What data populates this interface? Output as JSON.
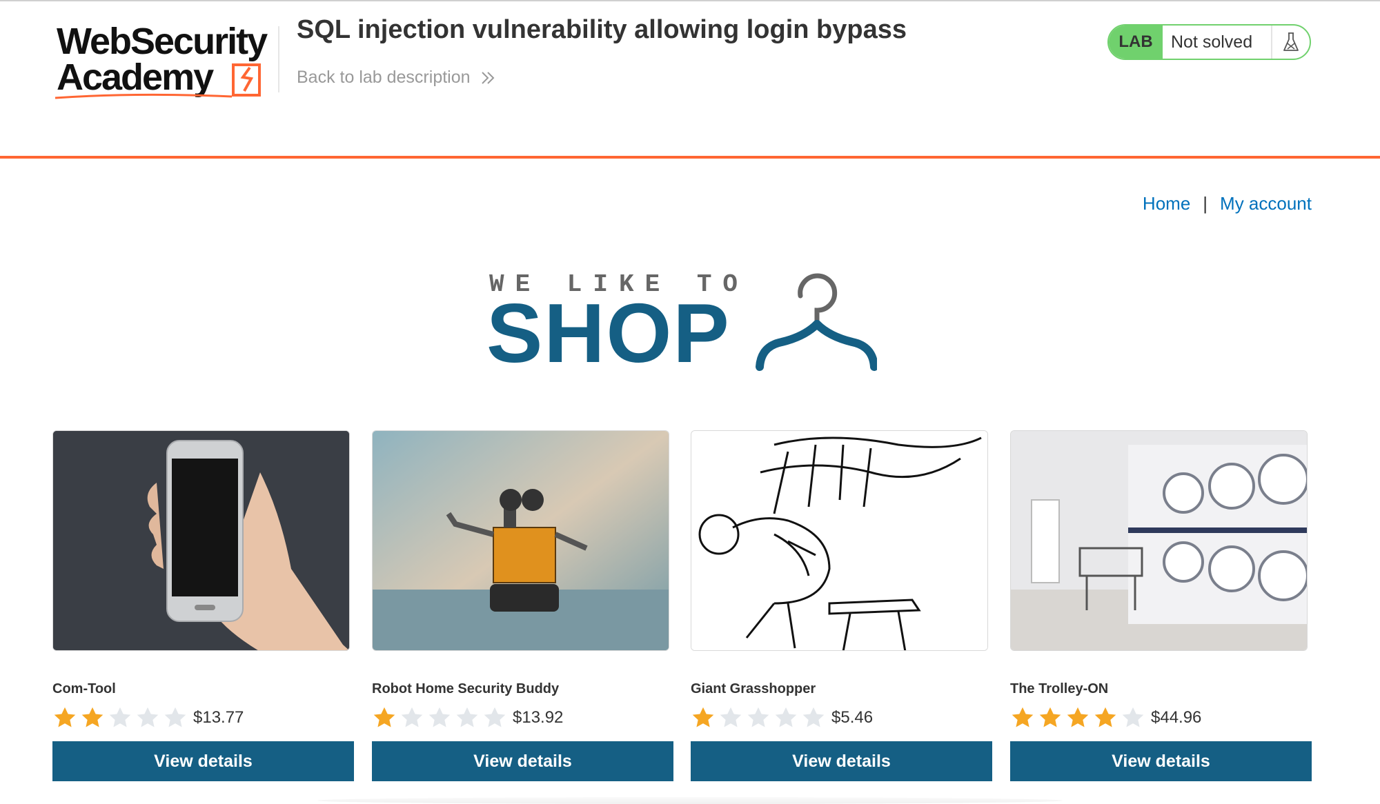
{
  "academy": {
    "logo_line1": "WebSecurity",
    "logo_line2": "Academy",
    "lab_title": "SQL injection vulnerability allowing login bypass",
    "back_link": "Back to lab description",
    "lab_badge": "LAB",
    "lab_status": "Not solved",
    "flask_icon": "flask-icon"
  },
  "colors": {
    "accent_orange": "#ff6633",
    "lab_green": "#70d16d",
    "shop_blue": "#155f84",
    "link_blue": "#0071bc",
    "star_gold": "#f5a623",
    "star_gray": "#e2e6ea"
  },
  "nav": {
    "home": "Home",
    "separator": "|",
    "my_account": "My account"
  },
  "banner": {
    "we_like_to": "WE LIKE TO",
    "shop": "SHOP",
    "hanger_icon": "hanger-icon"
  },
  "products": [
    {
      "name": "Com-Tool",
      "rating": 2,
      "price": "$13.77",
      "button": "View details",
      "image": "phone-in-hand-image"
    },
    {
      "name": "Robot Home Security Buddy",
      "rating": 1,
      "price": "$13.92",
      "button": "View details",
      "image": "robot-toy-image"
    },
    {
      "name": "Giant Grasshopper",
      "rating": 1,
      "price": "$5.46",
      "button": "View details",
      "image": "grasshopper-sketch-image"
    },
    {
      "name": "The Trolley-ON",
      "rating": 4,
      "price": "$44.96",
      "button": "View details",
      "image": "laundromat-image"
    }
  ]
}
